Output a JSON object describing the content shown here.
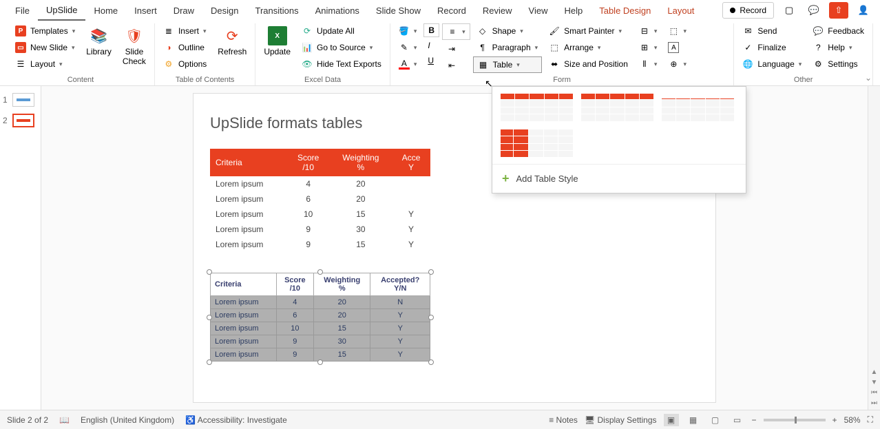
{
  "menubar": {
    "items": [
      "File",
      "UpSlide",
      "Home",
      "Insert",
      "Draw",
      "Design",
      "Transitions",
      "Animations",
      "Slide Show",
      "Record",
      "Review",
      "View",
      "Help",
      "Table Design",
      "Layout"
    ],
    "record": "Record"
  },
  "ribbon": {
    "groups": {
      "content": {
        "label": "Content",
        "templates": "Templates",
        "newslide": "New Slide",
        "layout": "Layout",
        "library": "Library",
        "slidecheck": "Slide\nCheck"
      },
      "toc": {
        "label": "Table of Contents",
        "insert": "Insert",
        "outline": "Outline",
        "options": "Options",
        "refresh": "Refresh"
      },
      "excel": {
        "label": "Excel Data",
        "update": "Update",
        "updateall": "Update All",
        "gotosource": "Go to Source",
        "hidetext": "Hide Text Exports"
      },
      "format": {
        "label": "Form",
        "shape": "Shape",
        "paragraph": "Paragraph",
        "table": "Table",
        "smartpainter": "Smart Painter",
        "arrange": "Arrange",
        "sizepos": "Size and Position"
      },
      "other": {
        "label": "Other",
        "send": "Send",
        "finalize": "Finalize",
        "language": "Language",
        "feedback": "Feedback",
        "help": "Help",
        "settings": "Settings"
      }
    }
  },
  "slide": {
    "title": "UpSlide formats tables",
    "table1": {
      "headers": [
        "Criteria",
        "Score\n/10",
        "Weighting\n%",
        "Acce\nY"
      ],
      "rows": [
        [
          "Lorem ipsum",
          "4",
          "20",
          ""
        ],
        [
          "Lorem ipsum",
          "6",
          "20",
          ""
        ],
        [
          "Lorem ipsum",
          "10",
          "15",
          "Y"
        ],
        [
          "Lorem ipsum",
          "9",
          "30",
          "Y"
        ],
        [
          "Lorem ipsum",
          "9",
          "15",
          "Y"
        ]
      ]
    },
    "table2": {
      "headers": [
        "Criteria",
        "Score\n/10",
        "Weighting\n%",
        "Accepted?\nY/N"
      ],
      "rows": [
        [
          "Lorem ipsum",
          "4",
          "20",
          "N"
        ],
        [
          "Lorem ipsum",
          "6",
          "20",
          "Y"
        ],
        [
          "Lorem ipsum",
          "10",
          "15",
          "Y"
        ],
        [
          "Lorem ipsum",
          "9",
          "30",
          "Y"
        ],
        [
          "Lorem ipsum",
          "9",
          "15",
          "Y"
        ]
      ]
    }
  },
  "dropdown": {
    "addstyle": "Add Table Style"
  },
  "thumbs": {
    "n1": "1",
    "n2": "2"
  },
  "statusbar": {
    "slideinfo": "Slide 2 of 2",
    "language": "English (United Kingdom)",
    "accessibility": "Accessibility: Investigate",
    "notes": "Notes",
    "display": "Display Settings",
    "zoom": "58%"
  }
}
